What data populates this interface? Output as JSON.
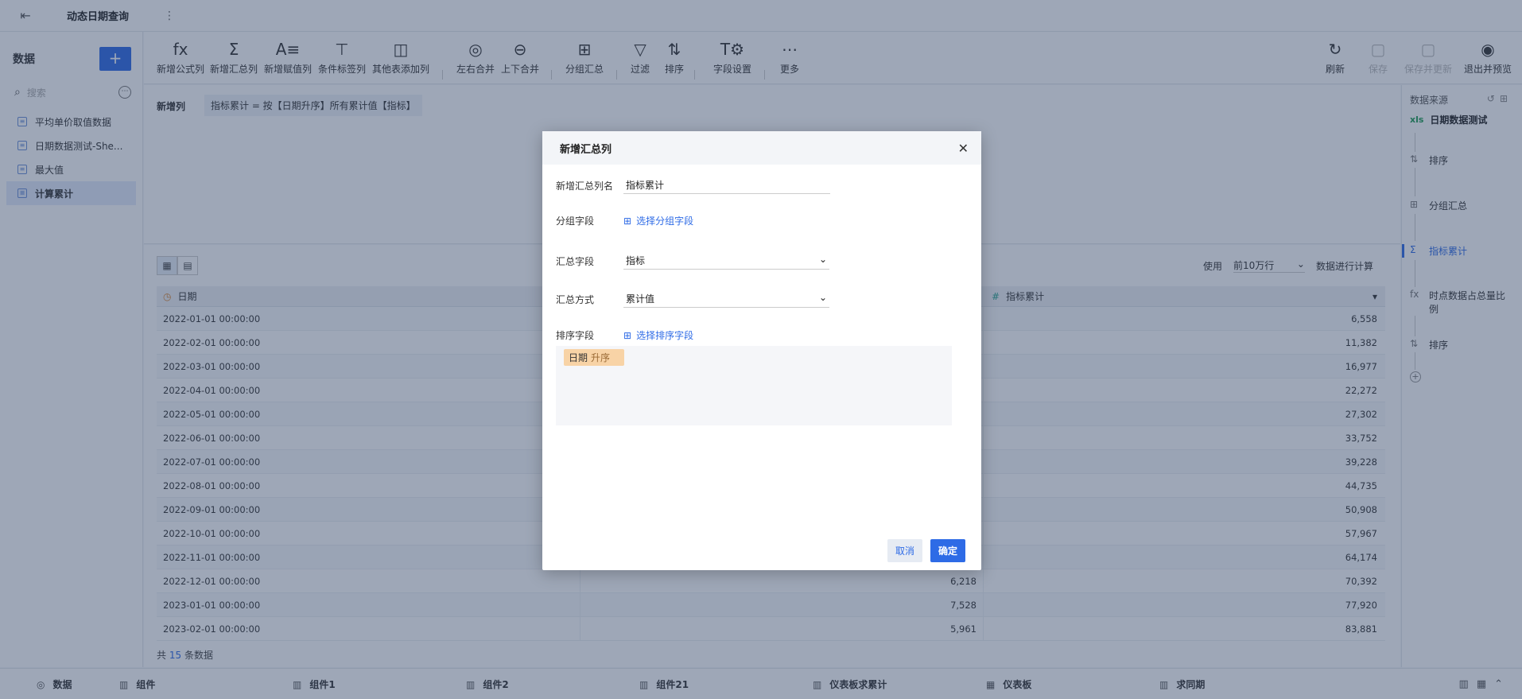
{
  "topbar": {
    "back_icon": "exit-icon",
    "title": "动态日期查询",
    "more": "⋮"
  },
  "left": {
    "title": "数据",
    "add": "+",
    "search_placeholder": "搜索",
    "items": [
      {
        "label": "平均单价取值数据",
        "active": false
      },
      {
        "label": "日期数据测试-She...",
        "active": false
      },
      {
        "label": "最大值",
        "active": false
      },
      {
        "label": "计算累计",
        "active": true
      }
    ]
  },
  "toolbar": {
    "items": [
      {
        "label": "新增公式列",
        "icon": "fx"
      },
      {
        "label": "新增汇总列",
        "icon": "Σ"
      },
      {
        "label": "新增赋值列",
        "icon": "A≡"
      },
      {
        "label": "条件标签列",
        "icon": "⊤"
      },
      {
        "label": "其他表添加列",
        "icon": "◫"
      },
      {
        "label": "左右合并",
        "icon": "◎"
      },
      {
        "label": "上下合并",
        "icon": "⊖"
      },
      {
        "label": "分组汇总",
        "icon": "⊞"
      },
      {
        "label": "过滤",
        "icon": "▽"
      },
      {
        "label": "排序",
        "icon": "⇅"
      },
      {
        "label": "字段设置",
        "icon": "T⚙"
      },
      {
        "label": "更多",
        "icon": "⋯"
      }
    ],
    "right": [
      {
        "label": "刷新",
        "icon": "↻",
        "disabled": false
      },
      {
        "label": "保存",
        "icon": "▢",
        "disabled": true
      },
      {
        "label": "保存并更新",
        "icon": "▢",
        "disabled": true
      },
      {
        "label": "退出并预览",
        "icon": "◉",
        "disabled": false
      }
    ]
  },
  "formula": {
    "label": "新增列",
    "expression": "指标累计 = 按【日期升序】所有累计值【指标】"
  },
  "right_panel": {
    "title": "数据来源",
    "source_badge": "xls",
    "source_name": "日期数据测试",
    "steps": [
      {
        "icon": "⇅",
        "label": "排序",
        "active": false
      },
      {
        "icon": "⊞",
        "label": "分组汇总",
        "active": false
      },
      {
        "icon": "Σ",
        "label": "指标累计",
        "active": true
      },
      {
        "icon": "fx",
        "label": "时点数据占总量比例",
        "active": false
      },
      {
        "icon": "⇅",
        "label": "排序",
        "active": false
      }
    ]
  },
  "table": {
    "use_label": "使用",
    "use_value": "前10万行",
    "use_suffix": "数据进行计算",
    "headers": [
      "日期",
      "",
      "指标累计"
    ],
    "rows": [
      [
        "2022-01-01 00:00:00",
        "",
        "6,558"
      ],
      [
        "2022-02-01 00:00:00",
        "",
        "11,382"
      ],
      [
        "2022-03-01 00:00:00",
        "",
        "16,977"
      ],
      [
        "2022-04-01 00:00:00",
        "",
        "22,272"
      ],
      [
        "2022-05-01 00:00:00",
        "",
        "27,302"
      ],
      [
        "2022-06-01 00:00:00",
        "",
        "33,752"
      ],
      [
        "2022-07-01 00:00:00",
        "",
        "39,228"
      ],
      [
        "2022-08-01 00:00:00",
        "",
        "44,735"
      ],
      [
        "2022-09-01 00:00:00",
        "",
        "50,908"
      ],
      [
        "2022-10-01 00:00:00",
        "",
        "57,967"
      ],
      [
        "2022-11-01 00:00:00",
        "",
        "64,174"
      ],
      [
        "2022-12-01 00:00:00",
        "6,218",
        "70,392"
      ],
      [
        "2023-01-01 00:00:00",
        "7,528",
        "77,920"
      ],
      [
        "2023-02-01 00:00:00",
        "5,961",
        "83,881"
      ]
    ],
    "footer_prefix": "共",
    "footer_count": "15",
    "footer_suffix": "条数据"
  },
  "bottom_tabs": [
    "数据",
    "组件",
    "组件1",
    "组件2",
    "组件21",
    "仪表板求累计",
    "仪表板",
    "求同期"
  ],
  "dialog": {
    "title": "新增汇总列",
    "name_label": "新增汇总列名",
    "name_value": "指标累计",
    "group_label": "分组字段",
    "group_link": "选择分组字段",
    "sum_field_label": "汇总字段",
    "sum_field_value": "指标",
    "sum_method_label": "汇总方式",
    "sum_method_value": "累计值",
    "sort_label": "排序字段",
    "sort_link": "选择排序字段",
    "sort_chip_field": "日期",
    "sort_chip_order": "升序",
    "cancel": "取消",
    "ok": "确定"
  },
  "colors": {
    "accent": "#2e6be6",
    "chip": "#f8d3a6"
  }
}
